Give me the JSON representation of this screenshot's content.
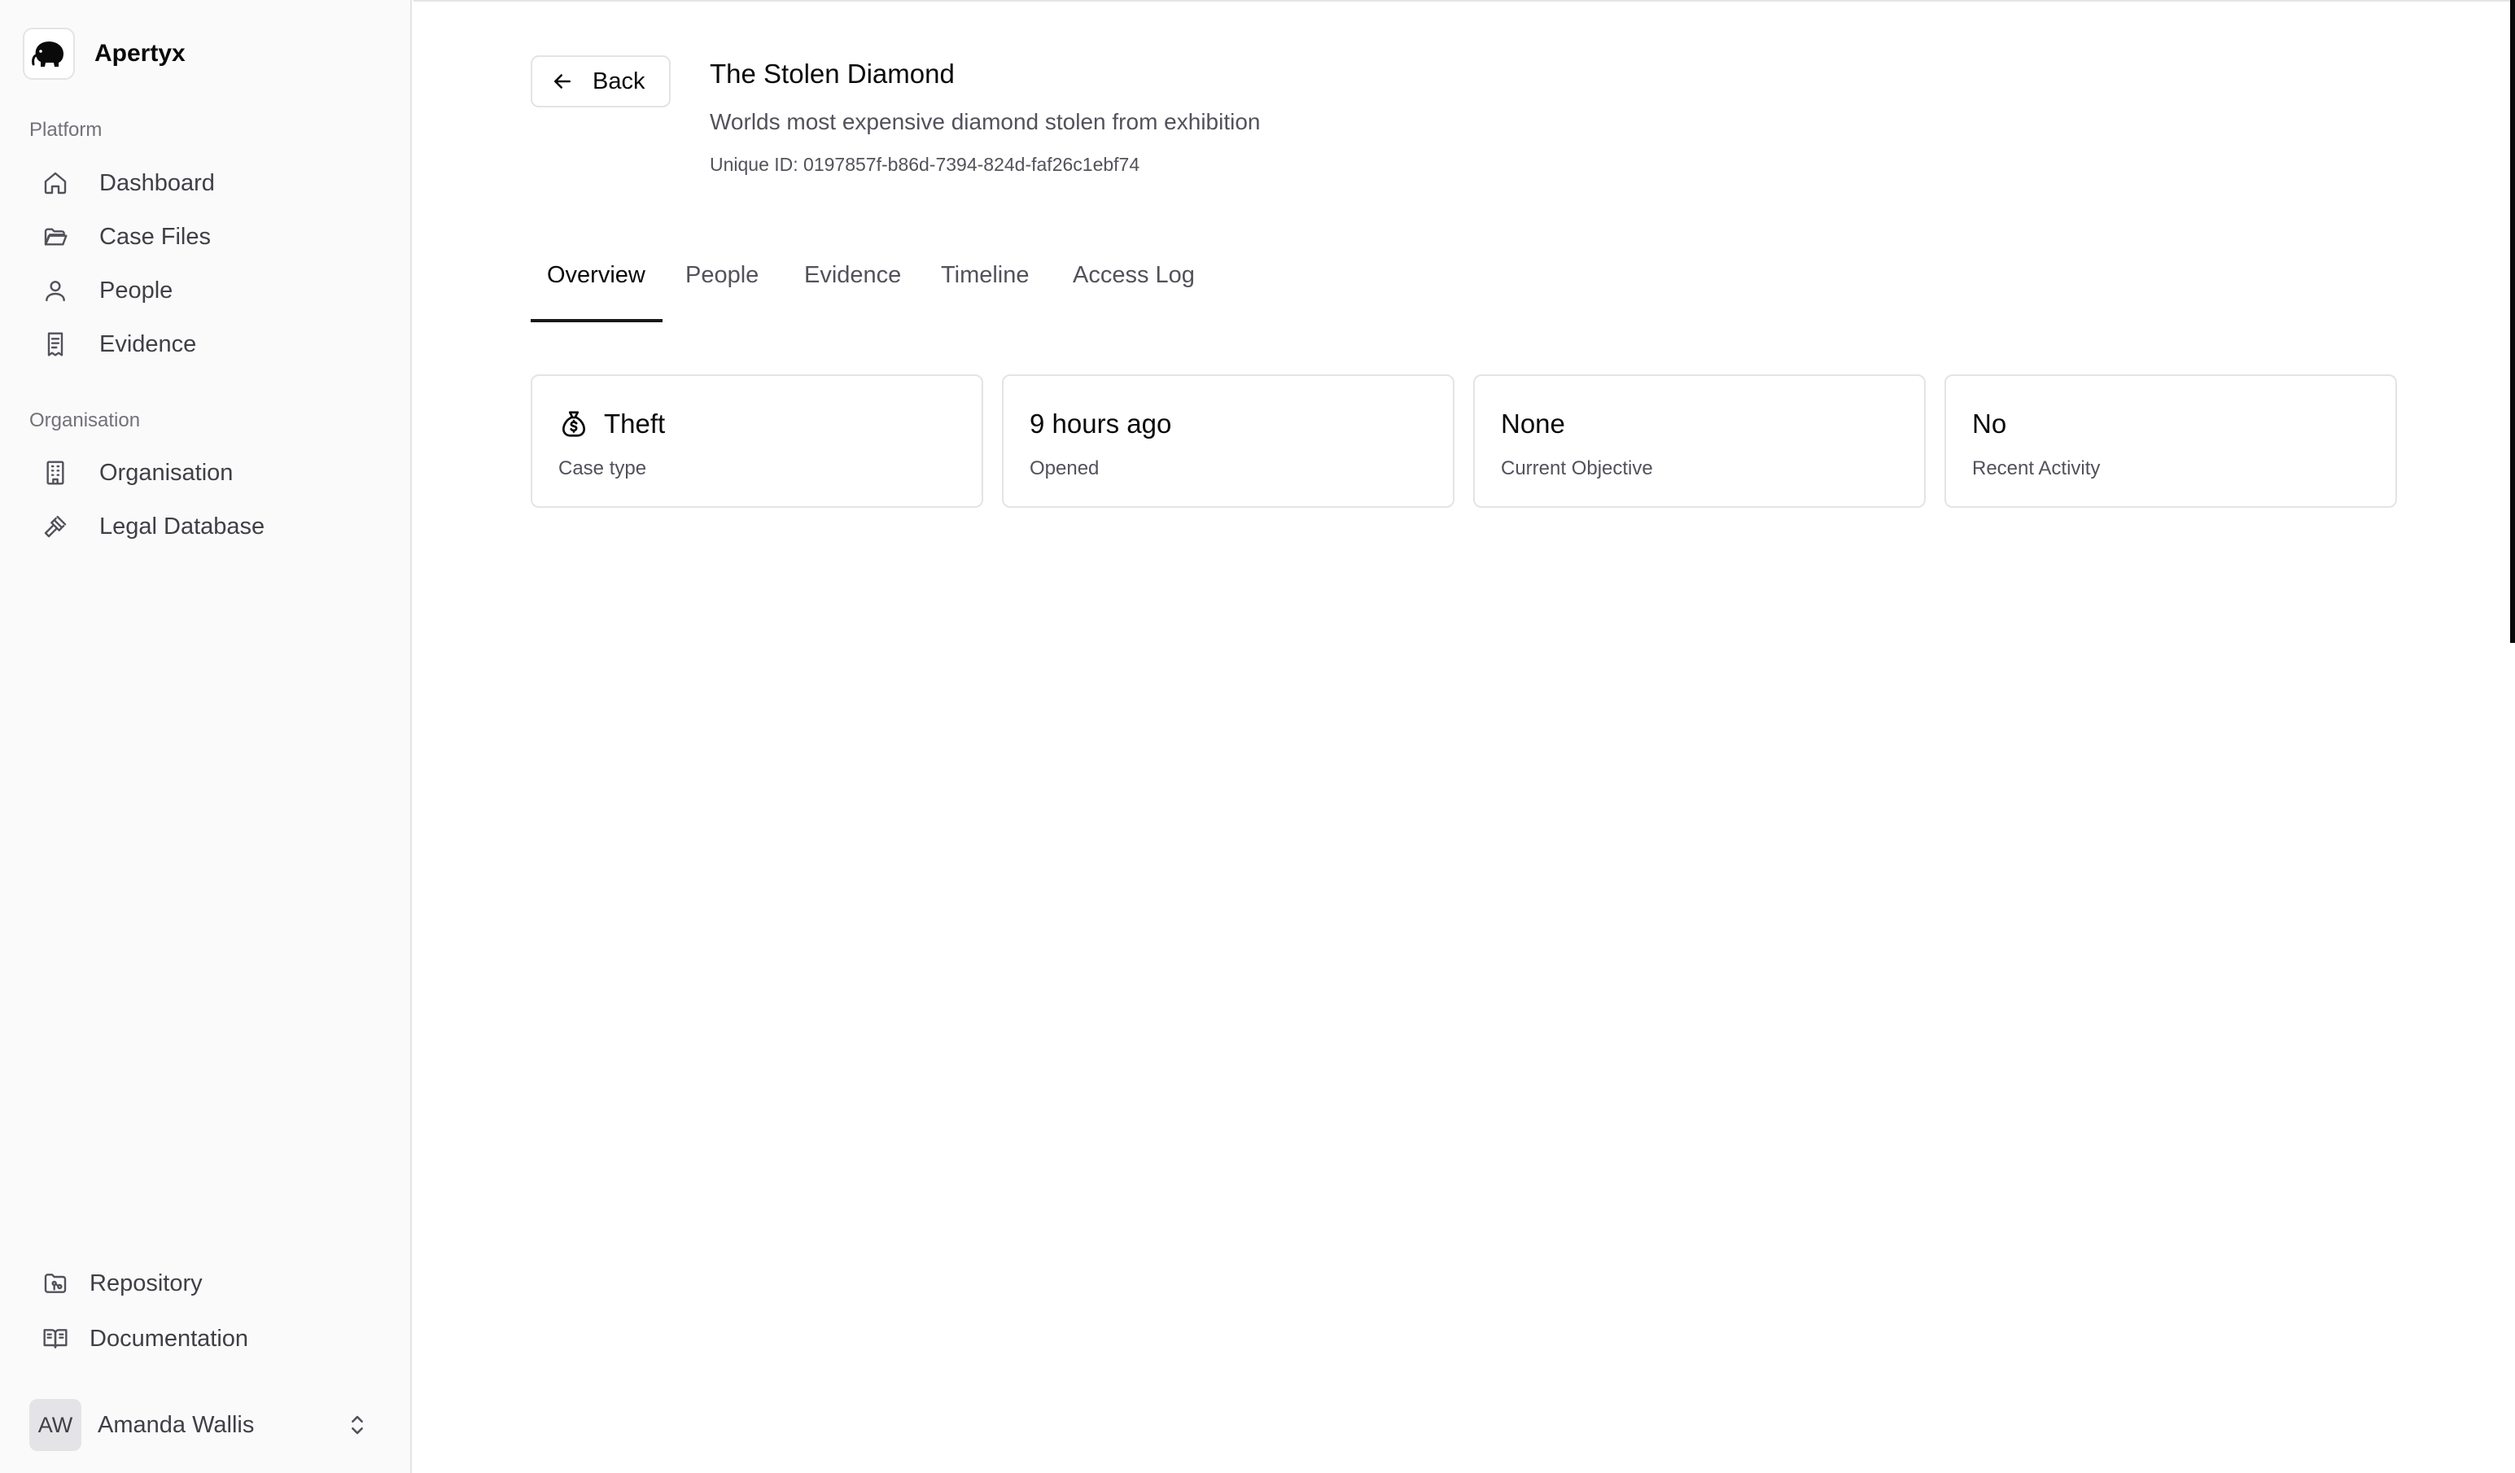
{
  "app": {
    "name": "Apertyx"
  },
  "sidebar": {
    "platform_label": "Platform",
    "platform_items": [
      {
        "label": "Dashboard",
        "icon": "home-icon"
      },
      {
        "label": "Case Files",
        "icon": "folder-open-icon"
      },
      {
        "label": "People",
        "icon": "user-icon"
      },
      {
        "label": "Evidence",
        "icon": "receipt-icon"
      }
    ],
    "organisation_label": "Organisation",
    "organisation_items": [
      {
        "label": "Organisation",
        "icon": "building-icon"
      },
      {
        "label": "Legal Database",
        "icon": "gavel-icon"
      }
    ],
    "footer_items": [
      {
        "label": "Repository",
        "icon": "folder-git-icon"
      },
      {
        "label": "Documentation",
        "icon": "book-icon"
      }
    ],
    "user": {
      "initials": "AW",
      "name": "Amanda Wallis"
    }
  },
  "header": {
    "back_label": "Back",
    "title": "The Stolen Diamond",
    "description": "Worlds most expensive diamond stolen from exhibition",
    "unique_id": "Unique ID: 0197857f-b86d-7394-824d-faf26c1ebf74"
  },
  "tabs": [
    {
      "label": "Overview",
      "active": true
    },
    {
      "label": "People",
      "active": false
    },
    {
      "label": "Evidence",
      "active": false
    },
    {
      "label": "Timeline",
      "active": false
    },
    {
      "label": "Access Log",
      "active": false
    }
  ],
  "cards": [
    {
      "value": "Theft",
      "label": "Case type",
      "icon": "money-bag-icon"
    },
    {
      "value": "9 hours ago",
      "label": "Opened"
    },
    {
      "value": "None",
      "label": "Current Objective"
    },
    {
      "value": "No",
      "label": "Recent Activity"
    }
  ],
  "colors": {
    "accent": "#18181b",
    "muted_text": "#52525b",
    "border": "#e4e4e7",
    "sidebar_bg": "#fafafa"
  }
}
